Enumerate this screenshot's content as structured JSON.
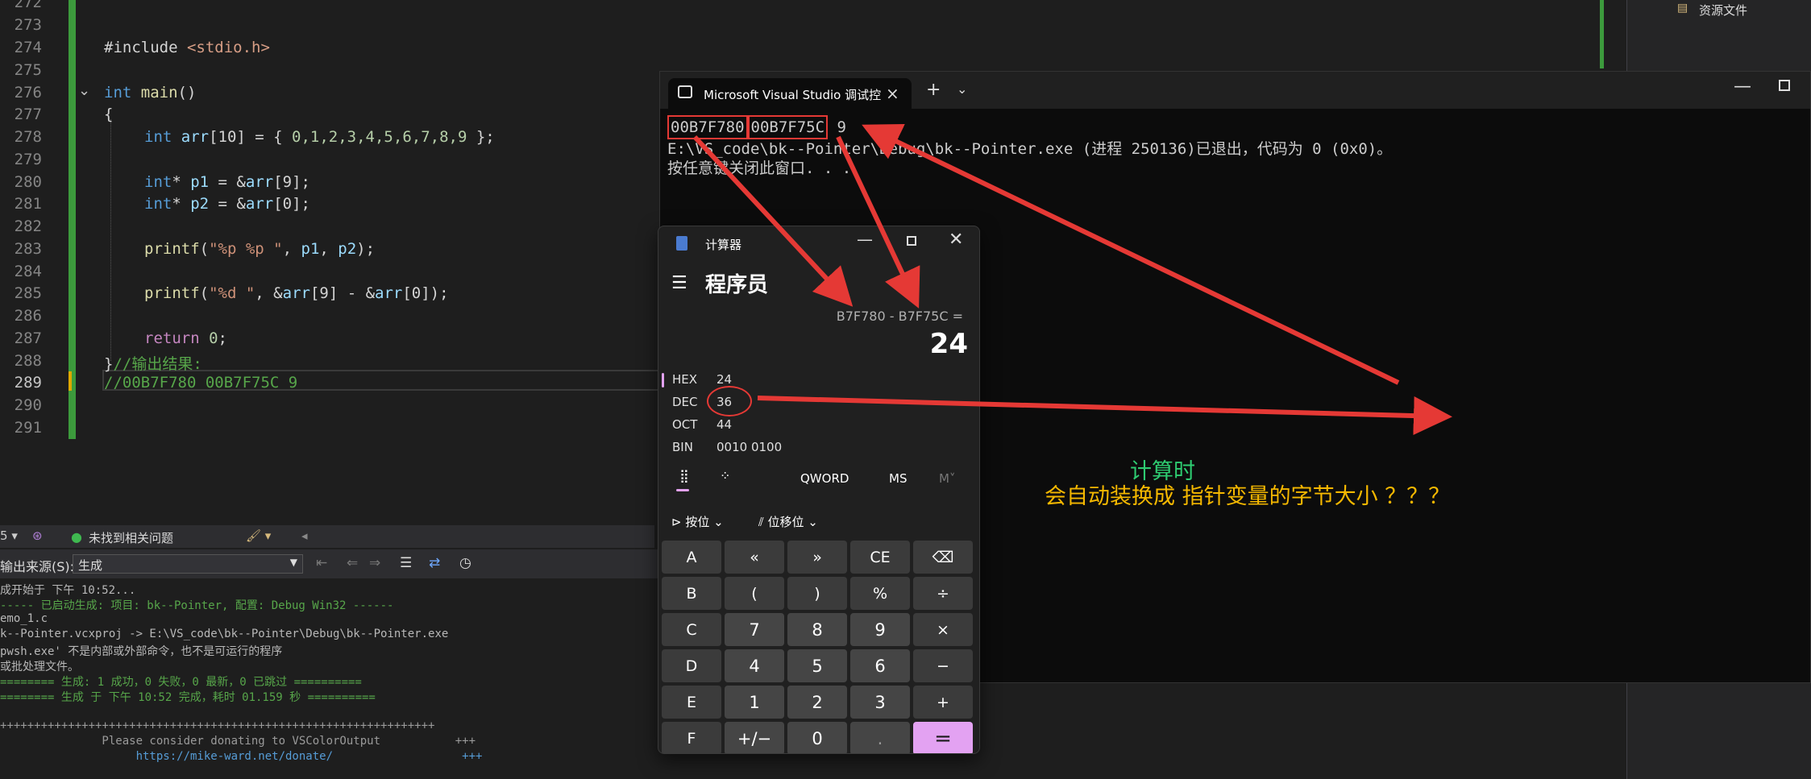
{
  "editor": {
    "lines": [
      {
        "n": "272",
        "code": ""
      },
      {
        "n": "273",
        "code": ""
      },
      {
        "n": "274",
        "code": "#include <stdio.h>"
      },
      {
        "n": "275",
        "code": ""
      },
      {
        "n": "276",
        "code": "int main()"
      },
      {
        "n": "277",
        "code": "{"
      },
      {
        "n": "278",
        "code": "    int arr[10] = { 0,1,2,3,4,5,6,7,8,9 };"
      },
      {
        "n": "279",
        "code": ""
      },
      {
        "n": "280",
        "code": "    int* p1 = &arr[9];"
      },
      {
        "n": "281",
        "code": "    int* p2 = &arr[0];"
      },
      {
        "n": "282",
        "code": ""
      },
      {
        "n": "283",
        "code": "    printf(\"%p %p \", p1, p2);"
      },
      {
        "n": "284",
        "code": ""
      },
      {
        "n": "285",
        "code": "    printf(\"%d \", &arr[9] - &arr[0]);"
      },
      {
        "n": "286",
        "code": ""
      },
      {
        "n": "287",
        "code": "    return 0;"
      },
      {
        "n": "288",
        "code": "}//输出结果:"
      },
      {
        "n": "289",
        "code": "//00B7F780 00B7F75C 9"
      },
      {
        "n": "290",
        "code": ""
      },
      {
        "n": "291",
        "code": ""
      }
    ],
    "code_tokens": {
      "l274a": "#include ",
      "l274b": "<stdio.h>",
      "l276a": "int",
      "l276b": " main",
      "l276c": "()",
      "l277": "{",
      "l278a": "int",
      "l278b": " arr",
      "l278c": "[10] = { ",
      "l278d": "0,1,2,3,4,5,6,7,8,9",
      "l278e": " };",
      "l280a": "int",
      "l280b": "* ",
      "l280c": "p1",
      "l280d": " = &",
      "l280e": "arr",
      "l280f": "[9];",
      "l281a": "int",
      "l281b": "* ",
      "l281c": "p2",
      "l281d": " = &",
      "l281e": "arr",
      "l281f": "[0];",
      "l283a": "printf",
      "l283b": "(",
      "l283c": "\"%p %p \"",
      "l283d": ", ",
      "l283e": "p1",
      "l283f": ", ",
      "l283g": "p2",
      "l283h": ");",
      "l285a": "printf",
      "l285b": "(",
      "l285c": "\"%d \"",
      "l285d": ", &",
      "l285e": "arr",
      "l285f": "[9] - &",
      "l285g": "arr",
      "l285h": "[0]);",
      "l287a": "return",
      "l287b": " 0",
      "l287c": ";",
      "l288a": "}",
      "l288b": "//输出结果:",
      "l289": "//00B7F780 00B7F75C 9"
    }
  },
  "explorer": {
    "item_label": "资源文件"
  },
  "statusbar": {
    "issues_text": "未找到相关问题",
    "left_value": "5"
  },
  "output": {
    "source_label": "输出来源(S):",
    "source_value": "生成",
    "lines": [
      "成开始于 下午 10:52...",
      "----- 已启动生成: 项目: bk--Pointer, 配置: Debug Win32 ------",
      "emo_1.c",
      "k--Pointer.vcxproj -> E:\\VS_code\\bk--Pointer\\Debug\\bk--Pointer.exe",
      "pwsh.exe' 不是内部或外部命令，也不是可运行的程序",
      "或批处理文件。",
      "======== 生成: 1 成功，0 失败，0 最新，0 已跳过 ==========",
      "======== 生成 于 下午 10:52 完成，耗时 01.159 秒 ==========",
      "",
      "++++++++++++++++++++++++++++++++++++++++++++++++++++++++++++++++",
      "               Please consider donating to VSColorOutput           +++",
      "                    https://mike-ward.net/donate/                   +++"
    ]
  },
  "console": {
    "tab_title": "Microsoft Visual Studio 调试控",
    "addr1": "00B7F780",
    "addr2": "00B7F75C",
    "diff": "9",
    "exit_line": "E:\\VS_code\\bk--Pointer\\Debug\\bk--Pointer.exe (进程 250136)已退出，代码为 0 (0x0)。",
    "press_line": "按任意键关闭此窗口. . ."
  },
  "calculator": {
    "title": "计算器",
    "mode": "程序员",
    "expression": "B7F780 - B7F75C =",
    "result": "24",
    "radix": [
      {
        "name": "HEX",
        "value": "24"
      },
      {
        "name": "DEC",
        "value": "36"
      },
      {
        "name": "OCT",
        "value": "44"
      },
      {
        "name": "BIN",
        "value": "0010 0100"
      }
    ],
    "word_size": "QWORD",
    "ms": "MS",
    "m_drop": "M˅",
    "bitwise_label": "按位",
    "shift_label": "位移位",
    "keys": [
      "A",
      "«",
      "»",
      "CE",
      "⌫",
      "B",
      "(",
      ")",
      "%",
      "÷",
      "C",
      "7",
      "8",
      "9",
      "×",
      "D",
      "4",
      "5",
      "6",
      "−",
      "E",
      "1",
      "2",
      "3",
      "+",
      "F",
      "+/−",
      "0",
      ".",
      "="
    ]
  },
  "annotations": {
    "line1": "计算时",
    "line2": "会自动装换成  指针变量的字节大小  ？？？"
  },
  "colors": {
    "accent": "#e3a2f2",
    "annotation_red": "#e53935",
    "note_green": "#2ecc71",
    "note_yellow": "#f5b800",
    "gutter_green": "#3c9a3c"
  }
}
